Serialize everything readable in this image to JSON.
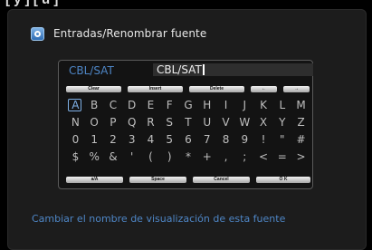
{
  "top_caption": "[ y ] [ u ]",
  "window": {
    "title": "Entradas/Renombrar fuente",
    "icon": "source-icon"
  },
  "source": {
    "label": "CBL/SAT",
    "value": "CBL/SAT"
  },
  "keys_top": [
    "Clear",
    "Insert",
    "Delete",
    "←",
    "→"
  ],
  "char_rows": [
    [
      "A",
      "B",
      "C",
      "D",
      "E",
      "F",
      "G",
      "H",
      "I",
      "J",
      "K",
      "L",
      "M"
    ],
    [
      "N",
      "O",
      "P",
      "Q",
      "R",
      "S",
      "T",
      "U",
      "V",
      "W",
      "X",
      "Y",
      "Z"
    ],
    [
      "0",
      "1",
      "2",
      "3",
      "4",
      "5",
      "6",
      "7",
      "8",
      "9",
      "!",
      "\"",
      "#"
    ],
    [
      "$",
      "%",
      "&",
      "'",
      "(",
      ")",
      "*",
      "+",
      ",",
      ";",
      "<",
      "=",
      ">"
    ]
  ],
  "selected_char": "A",
  "keys_bottom": [
    "a/A",
    "Space",
    "Cancel",
    "O K"
  ],
  "help_text": "Cambiar el nombre de visualización de esta fuente"
}
